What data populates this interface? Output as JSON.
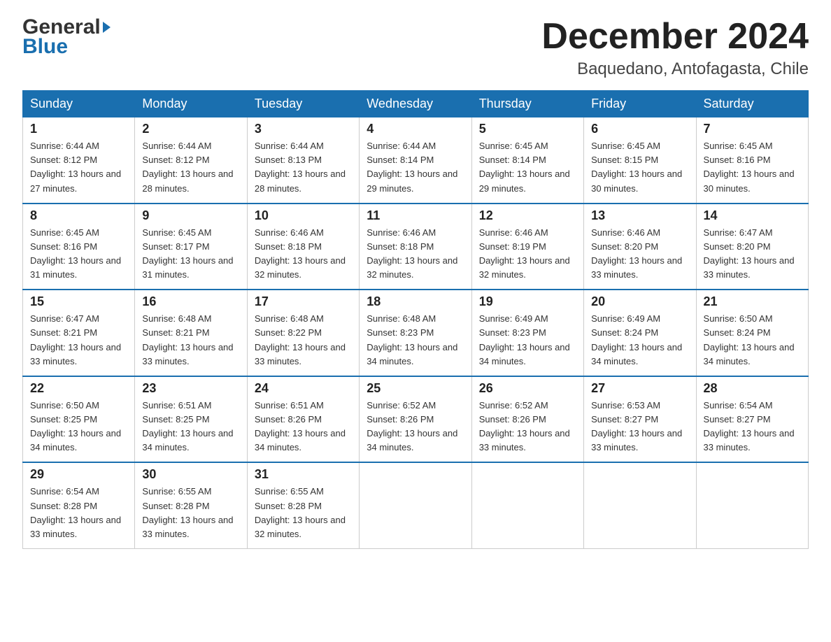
{
  "header": {
    "logo_general": "General",
    "logo_blue": "Blue",
    "month_title": "December 2024",
    "location": "Baquedano, Antofagasta, Chile"
  },
  "days_of_week": [
    "Sunday",
    "Monday",
    "Tuesday",
    "Wednesday",
    "Thursday",
    "Friday",
    "Saturday"
  ],
  "weeks": [
    [
      {
        "day": "1",
        "sunrise": "6:44 AM",
        "sunset": "8:12 PM",
        "daylight": "13 hours and 27 minutes."
      },
      {
        "day": "2",
        "sunrise": "6:44 AM",
        "sunset": "8:12 PM",
        "daylight": "13 hours and 28 minutes."
      },
      {
        "day": "3",
        "sunrise": "6:44 AM",
        "sunset": "8:13 PM",
        "daylight": "13 hours and 28 minutes."
      },
      {
        "day": "4",
        "sunrise": "6:44 AM",
        "sunset": "8:14 PM",
        "daylight": "13 hours and 29 minutes."
      },
      {
        "day": "5",
        "sunrise": "6:45 AM",
        "sunset": "8:14 PM",
        "daylight": "13 hours and 29 minutes."
      },
      {
        "day": "6",
        "sunrise": "6:45 AM",
        "sunset": "8:15 PM",
        "daylight": "13 hours and 30 minutes."
      },
      {
        "day": "7",
        "sunrise": "6:45 AM",
        "sunset": "8:16 PM",
        "daylight": "13 hours and 30 minutes."
      }
    ],
    [
      {
        "day": "8",
        "sunrise": "6:45 AM",
        "sunset": "8:16 PM",
        "daylight": "13 hours and 31 minutes."
      },
      {
        "day": "9",
        "sunrise": "6:45 AM",
        "sunset": "8:17 PM",
        "daylight": "13 hours and 31 minutes."
      },
      {
        "day": "10",
        "sunrise": "6:46 AM",
        "sunset": "8:18 PM",
        "daylight": "13 hours and 32 minutes."
      },
      {
        "day": "11",
        "sunrise": "6:46 AM",
        "sunset": "8:18 PM",
        "daylight": "13 hours and 32 minutes."
      },
      {
        "day": "12",
        "sunrise": "6:46 AM",
        "sunset": "8:19 PM",
        "daylight": "13 hours and 32 minutes."
      },
      {
        "day": "13",
        "sunrise": "6:46 AM",
        "sunset": "8:20 PM",
        "daylight": "13 hours and 33 minutes."
      },
      {
        "day": "14",
        "sunrise": "6:47 AM",
        "sunset": "8:20 PM",
        "daylight": "13 hours and 33 minutes."
      }
    ],
    [
      {
        "day": "15",
        "sunrise": "6:47 AM",
        "sunset": "8:21 PM",
        "daylight": "13 hours and 33 minutes."
      },
      {
        "day": "16",
        "sunrise": "6:48 AM",
        "sunset": "8:21 PM",
        "daylight": "13 hours and 33 minutes."
      },
      {
        "day": "17",
        "sunrise": "6:48 AM",
        "sunset": "8:22 PM",
        "daylight": "13 hours and 33 minutes."
      },
      {
        "day": "18",
        "sunrise": "6:48 AM",
        "sunset": "8:23 PM",
        "daylight": "13 hours and 34 minutes."
      },
      {
        "day": "19",
        "sunrise": "6:49 AM",
        "sunset": "8:23 PM",
        "daylight": "13 hours and 34 minutes."
      },
      {
        "day": "20",
        "sunrise": "6:49 AM",
        "sunset": "8:24 PM",
        "daylight": "13 hours and 34 minutes."
      },
      {
        "day": "21",
        "sunrise": "6:50 AM",
        "sunset": "8:24 PM",
        "daylight": "13 hours and 34 minutes."
      }
    ],
    [
      {
        "day": "22",
        "sunrise": "6:50 AM",
        "sunset": "8:25 PM",
        "daylight": "13 hours and 34 minutes."
      },
      {
        "day": "23",
        "sunrise": "6:51 AM",
        "sunset": "8:25 PM",
        "daylight": "13 hours and 34 minutes."
      },
      {
        "day": "24",
        "sunrise": "6:51 AM",
        "sunset": "8:26 PM",
        "daylight": "13 hours and 34 minutes."
      },
      {
        "day": "25",
        "sunrise": "6:52 AM",
        "sunset": "8:26 PM",
        "daylight": "13 hours and 34 minutes."
      },
      {
        "day": "26",
        "sunrise": "6:52 AM",
        "sunset": "8:26 PM",
        "daylight": "13 hours and 33 minutes."
      },
      {
        "day": "27",
        "sunrise": "6:53 AM",
        "sunset": "8:27 PM",
        "daylight": "13 hours and 33 minutes."
      },
      {
        "day": "28",
        "sunrise": "6:54 AM",
        "sunset": "8:27 PM",
        "daylight": "13 hours and 33 minutes."
      }
    ],
    [
      {
        "day": "29",
        "sunrise": "6:54 AM",
        "sunset": "8:28 PM",
        "daylight": "13 hours and 33 minutes."
      },
      {
        "day": "30",
        "sunrise": "6:55 AM",
        "sunset": "8:28 PM",
        "daylight": "13 hours and 33 minutes."
      },
      {
        "day": "31",
        "sunrise": "6:55 AM",
        "sunset": "8:28 PM",
        "daylight": "13 hours and 32 minutes."
      },
      null,
      null,
      null,
      null
    ]
  ]
}
